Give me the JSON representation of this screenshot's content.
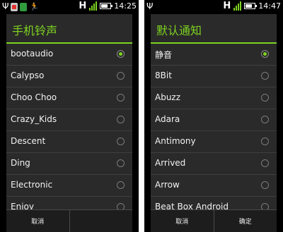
{
  "left": {
    "status": {
      "time": "14:25",
      "network": "H"
    },
    "dialog": {
      "title": "手机铃声",
      "items": [
        {
          "label": "bootaudio",
          "selected": true
        },
        {
          "label": "Calypso",
          "selected": false
        },
        {
          "label": "Choo Choo",
          "selected": false
        },
        {
          "label": "Crazy_Kids",
          "selected": false
        },
        {
          "label": "Descent",
          "selected": false
        },
        {
          "label": "Ding",
          "selected": false
        },
        {
          "label": "Electronic",
          "selected": false
        },
        {
          "label": "Enjoy",
          "selected": false
        }
      ],
      "buttons": {
        "cancel": "取消",
        "ok": ""
      }
    }
  },
  "right": {
    "status": {
      "time": "14:47",
      "network": "H"
    },
    "dialog": {
      "title": "默认通知",
      "items": [
        {
          "label": "静音",
          "selected": true
        },
        {
          "label": "8Bit",
          "selected": false
        },
        {
          "label": "Abuzz",
          "selected": false
        },
        {
          "label": "Adara",
          "selected": false
        },
        {
          "label": "Antimony",
          "selected": false
        },
        {
          "label": "Arrived",
          "selected": false
        },
        {
          "label": "Arrow",
          "selected": false
        },
        {
          "label": "Beat Box Android",
          "selected": false
        }
      ],
      "buttons": {
        "cancel": "取消",
        "ok": "确定"
      }
    }
  },
  "colors": {
    "accent": "#7ed321",
    "dialog_bg": "#2a2a2a",
    "divider": "#3f3f3f"
  },
  "icons": [
    "usb-icon",
    "app-notification-icon",
    "runner-icon",
    "signal-icon",
    "battery-icon"
  ]
}
